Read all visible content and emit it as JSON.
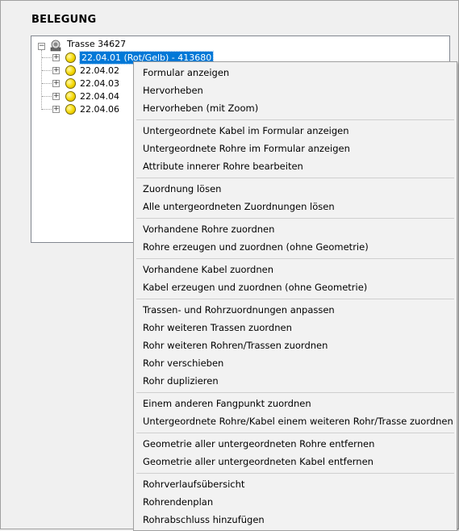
{
  "panel": {
    "title": "BELEGUNG"
  },
  "tree": {
    "root": {
      "label": "Trasse 34627",
      "icon": "route-node-icon"
    },
    "children": [
      {
        "label": "22.04.01 (Rot/Gelb) - 413680",
        "selected": true
      },
      {
        "label": "22.04.02"
      },
      {
        "label": "22.04.03"
      },
      {
        "label": "22.04.04"
      },
      {
        "label": "22.04.06"
      }
    ],
    "expander_collapsed": "+",
    "expander_expanded": "−"
  },
  "context_menu": {
    "groups": [
      [
        "Formular anzeigen",
        "Hervorheben",
        "Hervorheben (mit Zoom)"
      ],
      [
        "Untergeordnete Kabel im Formular anzeigen",
        "Untergeordnete Rohre im Formular anzeigen",
        "Attribute innerer Rohre bearbeiten"
      ],
      [
        "Zuordnung lösen",
        "Alle untergeordneten Zuordnungen lösen"
      ],
      [
        "Vorhandene Rohre zuordnen",
        "Rohre erzeugen und zuordnen (ohne Geometrie)"
      ],
      [
        "Vorhandene Kabel zuordnen",
        "Kabel erzeugen und zuordnen (ohne Geometrie)"
      ],
      [
        "Trassen- und Rohrzuordnungen anpassen",
        "Rohr weiteren Trassen zuordnen",
        "Rohr weiteren Rohren/Trassen zuordnen",
        "Rohr verschieben",
        "Rohr duplizieren"
      ],
      [
        "Einem anderen Fangpunkt zuordnen",
        "Untergeordnete Rohre/Kabel einem weiteren Rohr/Trasse zuordnen"
      ],
      [
        "Geometrie aller untergeordneten Rohre entfernen",
        "Geometrie aller untergeordneten Kabel entfernen"
      ],
      [
        "Rohrverlaufsübersicht",
        "Rohrendenplan",
        "Rohrabschluss hinzufügen"
      ]
    ]
  },
  "colors": {
    "selection": "#0078d7",
    "node_yellow": "#f4d800"
  }
}
